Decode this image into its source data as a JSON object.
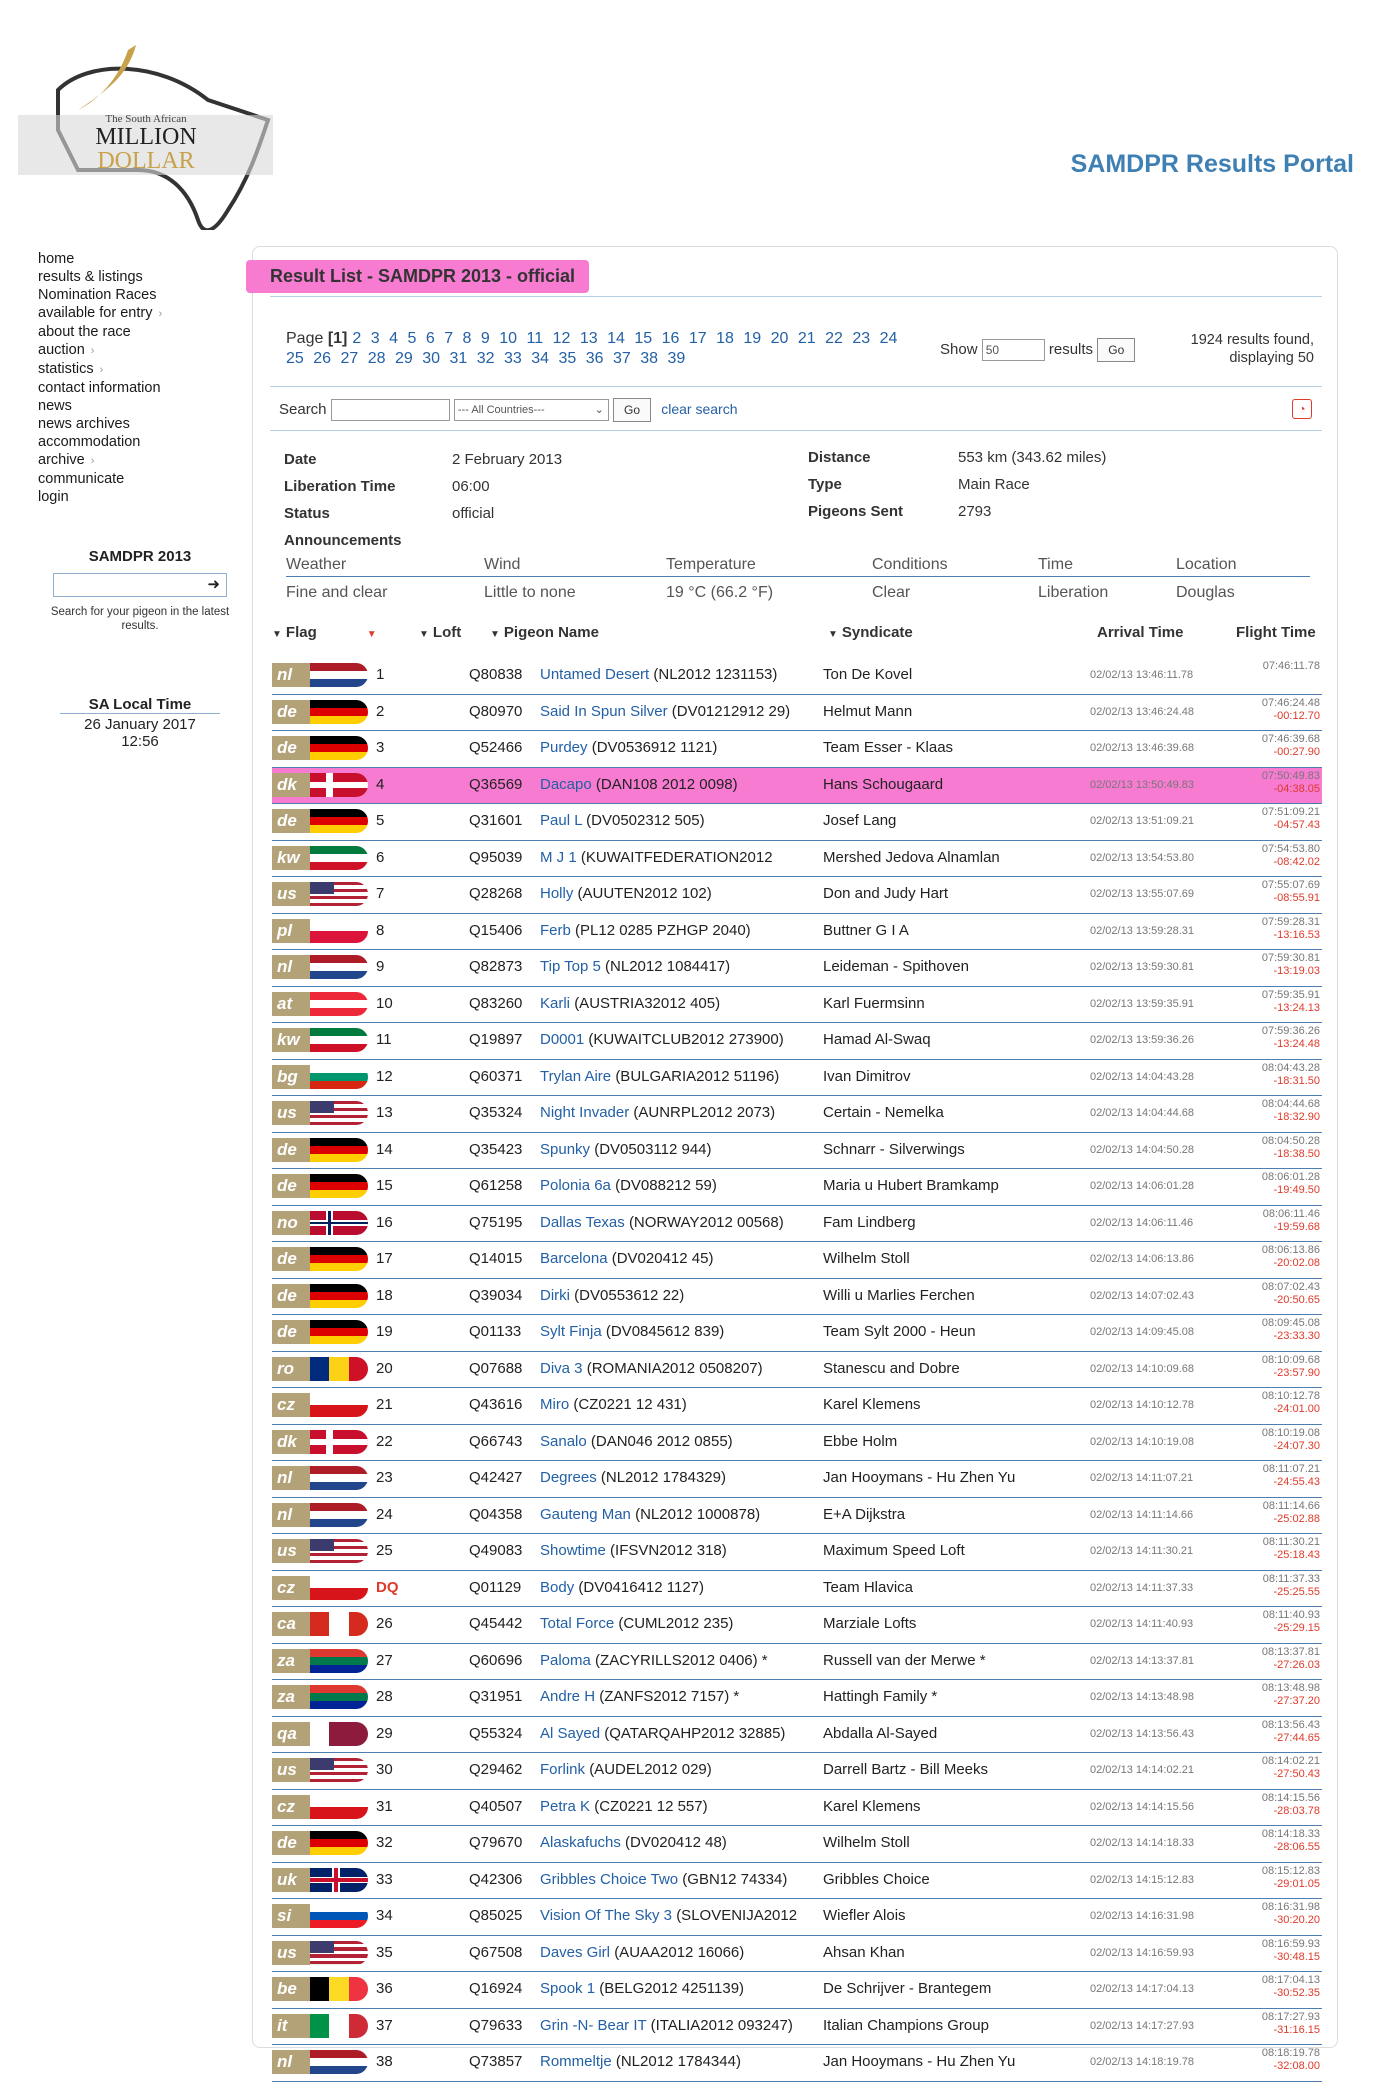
{
  "site": {
    "logo_small": "The South African",
    "logo_line1": "MILLION",
    "logo_line2": "DOLLAR",
    "portal_title": "SAMDPR Results Portal"
  },
  "nav": [
    "home",
    "results & listings",
    "Nomination Races",
    "available for entry",
    "about the race",
    "auction",
    "statistics",
    "contact information",
    "news",
    "news archives",
    "accommodation",
    "archive",
    "communicate",
    "login"
  ],
  "sidebox": {
    "title": "SAMDPR 2013",
    "hint": "Search for your pigeon in the latest results."
  },
  "localtime": {
    "title": "SA Local Time",
    "date": "26 January 2017",
    "time": "12:56"
  },
  "result": {
    "title": "Result List - SAMDPR 2013 - official",
    "page_label": "Page",
    "current_page": "[1]",
    "pages": [
      "2",
      "3",
      "4",
      "5",
      "6",
      "7",
      "8",
      "9",
      "10",
      "11",
      "12",
      "13",
      "14",
      "15",
      "16",
      "17",
      "18",
      "19",
      "20",
      "21",
      "22",
      "23",
      "24",
      "25",
      "26",
      "27",
      "28",
      "29",
      "30",
      "31",
      "32",
      "33",
      "34",
      "35",
      "36",
      "37",
      "38",
      "39"
    ],
    "show_label": "Show",
    "show_value": "50",
    "results_label": "results",
    "go": "Go",
    "found": "1924 results found, displaying 50"
  },
  "search": {
    "label": "Search",
    "country": "--- All Countries---",
    "go": "Go",
    "clear": "clear search"
  },
  "info": {
    "date_l": "Date",
    "date": "2 February 2013",
    "lib_l": "Liberation Time",
    "lib": "06:00",
    "status_l": "Status",
    "status": "official",
    "ann_l": "Announcements",
    "dist_l": "Distance",
    "dist": "553 km (343.62 miles)",
    "type_l": "Type",
    "type": "Main Race",
    "sent_l": "Pigeons Sent",
    "sent": "2793"
  },
  "weather": {
    "h": [
      "Weather",
      "Wind",
      "Temperature",
      "Conditions",
      "Time",
      "Location"
    ],
    "v": [
      "Fine and clear",
      "Little to none",
      "19 °C (66.2 °F)",
      "Clear",
      "Liberation",
      "Douglas"
    ]
  },
  "columns": {
    "flag": "Flag",
    "loft": "Loft",
    "name": "Pigeon Name",
    "synd": "Syndicate",
    "arr": "Arrival Time",
    "flight": "Flight Time"
  },
  "colors": {
    "accent": "#3f80b4",
    "highlight": "#f67bd1",
    "link": "#2360a5",
    "diff": "#e03a2a"
  },
  "rows": [
    {
      "c": "nl",
      "r": "1",
      "l": "Q80838",
      "n": "Untamed Desert",
      "ring": "(NL2012 1231153)",
      "s": "Ton De Kovel",
      "a": "02/02/13 13:46:11.78",
      "f": "07:46:11.78",
      "d": ""
    },
    {
      "c": "de",
      "r": "2",
      "l": "Q80970",
      "n": "Said In Spun Silver",
      "ring": "(DV01212912 29)",
      "s": "Helmut Mann",
      "a": "02/02/13 13:46:24.48",
      "f": "07:46:24.48",
      "d": "-00:12.70"
    },
    {
      "c": "de",
      "r": "3",
      "l": "Q52466",
      "n": "Purdey",
      "ring": "(DV0536912 1121)",
      "s": "Team Esser - Klaas",
      "a": "02/02/13 13:46:39.68",
      "f": "07:46:39.68",
      "d": "-00:27.90"
    },
    {
      "c": "dk",
      "r": "4",
      "l": "Q36569",
      "n": "Dacapo",
      "ring": "(DAN108 2012 0098)",
      "s": "Hans Schougaard",
      "a": "02/02/13 13:50:49.83",
      "f": "07:50:49.83",
      "d": "-04:38.05",
      "hl": true
    },
    {
      "c": "de",
      "r": "5",
      "l": "Q31601",
      "n": "Paul L",
      "ring": "(DV0502312 505)",
      "s": "Josef Lang",
      "a": "02/02/13 13:51:09.21",
      "f": "07:51:09.21",
      "d": "-04:57.43"
    },
    {
      "c": "kw",
      "r": "6",
      "l": "Q95039",
      "n": "M J 1",
      "ring": "(KUWAITFEDERATION2012",
      "s": "Mershed Jedova Alnamlan",
      "a": "02/02/13 13:54:53.80",
      "f": "07:54:53.80",
      "d": "-08:42.02"
    },
    {
      "c": "us",
      "r": "7",
      "l": "Q28268",
      "n": "Holly",
      "ring": "(AUUTEN2012 102)",
      "s": "Don and Judy Hart",
      "a": "02/02/13 13:55:07.69",
      "f": "07:55:07.69",
      "d": "-08:55.91"
    },
    {
      "c": "pl",
      "r": "8",
      "l": "Q15406",
      "n": "Ferb",
      "ring": "(PL12 0285 PZHGP 2040)",
      "s": "Buttner G I A",
      "a": "02/02/13 13:59:28.31",
      "f": "07:59:28.31",
      "d": "-13:16.53"
    },
    {
      "c": "nl",
      "r": "9",
      "l": "Q82873",
      "n": "Tip Top 5",
      "ring": "(NL2012 1084417)",
      "s": "Leideman - Spithoven",
      "a": "02/02/13 13:59:30.81",
      "f": "07:59:30.81",
      "d": "-13:19.03"
    },
    {
      "c": "at",
      "r": "10",
      "l": "Q83260",
      "n": "Karli",
      "ring": "(AUSTRIA32012 405)",
      "s": "Karl Fuermsinn",
      "a": "02/02/13 13:59:35.91",
      "f": "07:59:35.91",
      "d": "-13:24.13"
    },
    {
      "c": "kw",
      "r": "11",
      "l": "Q19897",
      "n": "D0001",
      "ring": "(KUWAITCLUB2012 273900)",
      "s": "Hamad Al-Swaq",
      "a": "02/02/13 13:59:36.26",
      "f": "07:59:36.26",
      "d": "-13:24.48"
    },
    {
      "c": "bg",
      "r": "12",
      "l": "Q60371",
      "n": "Trylan Aire",
      "ring": "(BULGARIA2012 51196)",
      "s": "Ivan Dimitrov",
      "a": "02/02/13 14:04:43.28",
      "f": "08:04:43.28",
      "d": "-18:31.50"
    },
    {
      "c": "us",
      "r": "13",
      "l": "Q35324",
      "n": "Night Invader",
      "ring": "(AUNRPL2012 2073)",
      "s": "Certain - Nemelka",
      "a": "02/02/13 14:04:44.68",
      "f": "08:04:44.68",
      "d": "-18:32.90"
    },
    {
      "c": "de",
      "r": "14",
      "l": "Q35423",
      "n": "Spunky",
      "ring": "(DV0503112 944)",
      "s": "Schnarr - Silverwings",
      "a": "02/02/13 14:04:50.28",
      "f": "08:04:50.28",
      "d": "-18:38.50"
    },
    {
      "c": "de",
      "r": "15",
      "l": "Q61258",
      "n": "Polonia 6a",
      "ring": "(DV088212 59)",
      "s": "Maria u Hubert Bramkamp",
      "a": "02/02/13 14:06:01.28",
      "f": "08:06:01.28",
      "d": "-19:49.50"
    },
    {
      "c": "no",
      "r": "16",
      "l": "Q75195",
      "n": "Dallas Texas",
      "ring": "(NORWAY2012 00568)",
      "s": "Fam Lindberg",
      "a": "02/02/13 14:06:11.46",
      "f": "08:06:11.46",
      "d": "-19:59.68"
    },
    {
      "c": "de",
      "r": "17",
      "l": "Q14015",
      "n": "Barcelona",
      "ring": "(DV020412 45)",
      "s": "Wilhelm Stoll",
      "a": "02/02/13 14:06:13.86",
      "f": "08:06:13.86",
      "d": "-20:02.08"
    },
    {
      "c": "de",
      "r": "18",
      "l": "Q39034",
      "n": "Dirki",
      "ring": "(DV0553612 22)",
      "s": "Willi u Marlies Ferchen",
      "a": "02/02/13 14:07:02.43",
      "f": "08:07:02.43",
      "d": "-20:50.65"
    },
    {
      "c": "de",
      "r": "19",
      "l": "Q01133",
      "n": "Sylt Finja",
      "ring": "(DV0845612 839)",
      "s": "Team Sylt 2000 - Heun",
      "a": "02/02/13 14:09:45.08",
      "f": "08:09:45.08",
      "d": "-23:33.30"
    },
    {
      "c": "ro",
      "r": "20",
      "l": "Q07688",
      "n": "Diva 3",
      "ring": "(ROMANIA2012 0508207)",
      "s": "Stanescu and Dobre",
      "a": "02/02/13 14:10:09.68",
      "f": "08:10:09.68",
      "d": "-23:57.90"
    },
    {
      "c": "cz",
      "r": "21",
      "l": "Q43616",
      "n": "Miro",
      "ring": "(CZ0221 12 431)",
      "s": "Karel Klemens",
      "a": "02/02/13 14:10:12.78",
      "f": "08:10:12.78",
      "d": "-24:01.00"
    },
    {
      "c": "dk",
      "r": "22",
      "l": "Q66743",
      "n": "Sanalo",
      "ring": "(DAN046 2012 0855)",
      "s": "Ebbe Holm",
      "a": "02/02/13 14:10:19.08",
      "f": "08:10:19.08",
      "d": "-24:07.30"
    },
    {
      "c": "nl",
      "r": "23",
      "l": "Q42427",
      "n": "Degrees",
      "ring": "(NL2012 1784329)",
      "s": "Jan Hooymans - Hu Zhen Yu",
      "a": "02/02/13 14:11:07.21",
      "f": "08:11:07.21",
      "d": "-24:55.43"
    },
    {
      "c": "nl",
      "r": "24",
      "l": "Q04358",
      "n": "Gauteng Man",
      "ring": "(NL2012 1000878)",
      "s": "E+A Dijkstra",
      "a": "02/02/13 14:11:14.66",
      "f": "08:11:14.66",
      "d": "-25:02.88"
    },
    {
      "c": "us",
      "r": "25",
      "l": "Q49083",
      "n": "Showtime",
      "ring": "(IFSVN2012 318)",
      "s": "Maximum Speed Loft",
      "a": "02/02/13 14:11:30.21",
      "f": "08:11:30.21",
      "d": "-25:18.43"
    },
    {
      "c": "cz",
      "r": "DQ",
      "l": "Q01129",
      "n": "Body",
      "ring": "(DV0416412 1127)",
      "s": "Team Hlavica",
      "a": "02/02/13 14:11:37.33",
      "f": "08:11:37.33",
      "d": "-25:25.55",
      "dq": true
    },
    {
      "c": "ca",
      "r": "26",
      "l": "Q45442",
      "n": "Total Force",
      "ring": "(CUML2012 235)",
      "s": "Marziale Lofts",
      "a": "02/02/13 14:11:40.93",
      "f": "08:11:40.93",
      "d": "-25:29.15"
    },
    {
      "c": "za",
      "r": "27",
      "l": "Q60696",
      "n": "Paloma",
      "ring": "(ZACYRILLS2012 0406) *",
      "s": "Russell van der Merwe *",
      "a": "02/02/13 14:13:37.81",
      "f": "08:13:37.81",
      "d": "-27:26.03"
    },
    {
      "c": "za",
      "r": "28",
      "l": "Q31951",
      "n": "Andre H",
      "ring": "(ZANFS2012 7157) *",
      "s": "Hattingh Family *",
      "a": "02/02/13 14:13:48.98",
      "f": "08:13:48.98",
      "d": "-27:37.20"
    },
    {
      "c": "qa",
      "r": "29",
      "l": "Q55324",
      "n": "Al Sayed",
      "ring": "(QATARQAHP2012 32885)",
      "s": "Abdalla Al-Sayed",
      "a": "02/02/13 14:13:56.43",
      "f": "08:13:56.43",
      "d": "-27:44.65"
    },
    {
      "c": "us",
      "r": "30",
      "l": "Q29462",
      "n": "Forlink",
      "ring": "(AUDEL2012 029)",
      "s": "Darrell Bartz - Bill Meeks",
      "a": "02/02/13 14:14:02.21",
      "f": "08:14:02.21",
      "d": "-27:50.43"
    },
    {
      "c": "cz",
      "r": "31",
      "l": "Q40507",
      "n": "Petra K",
      "ring": "(CZ0221 12 557)",
      "s": "Karel Klemens",
      "a": "02/02/13 14:14:15.56",
      "f": "08:14:15.56",
      "d": "-28:03.78"
    },
    {
      "c": "de",
      "r": "32",
      "l": "Q79670",
      "n": "Alaskafuchs",
      "ring": "(DV020412 48)",
      "s": "Wilhelm Stoll",
      "a": "02/02/13 14:14:18.33",
      "f": "08:14:18.33",
      "d": "-28:06.55"
    },
    {
      "c": "uk",
      "r": "33",
      "l": "Q42306",
      "n": "Gribbles Choice Two",
      "ring": "(GBN12 74334)",
      "s": "Gribbles Choice",
      "a": "02/02/13 14:15:12.83",
      "f": "08:15:12.83",
      "d": "-29:01.05"
    },
    {
      "c": "si",
      "r": "34",
      "l": "Q85025",
      "n": "Vision Of The Sky 3",
      "ring": "(SLOVENIJA2012",
      "s": "Wiefler Alois",
      "a": "02/02/13 14:16:31.98",
      "f": "08:16:31.98",
      "d": "-30:20.20"
    },
    {
      "c": "us",
      "r": "35",
      "l": "Q67508",
      "n": "Daves Girl",
      "ring": "(AUAA2012 16066)",
      "s": "Ahsan Khan",
      "a": "02/02/13 14:16:59.93",
      "f": "08:16:59.93",
      "d": "-30:48.15"
    },
    {
      "c": "be",
      "r": "36",
      "l": "Q16924",
      "n": "Spook 1",
      "ring": "(BELG2012 4251139)",
      "s": "De Schrijver - Brantegem",
      "a": "02/02/13 14:17:04.13",
      "f": "08:17:04.13",
      "d": "-30:52.35"
    },
    {
      "c": "it",
      "r": "37",
      "l": "Q79633",
      "n": "Grin -N- Bear IT",
      "ring": "(ITALIA2012 093247)",
      "s": "Italian Champions Group",
      "a": "02/02/13 14:17:27.93",
      "f": "08:17:27.93",
      "d": "-31:16.15"
    },
    {
      "c": "nl",
      "r": "38",
      "l": "Q73857",
      "n": "Rommeltje",
      "ring": "(NL2012 1784344)",
      "s": "Jan Hooymans - Hu Zhen Yu",
      "a": "02/02/13 14:18:19.78",
      "f": "08:18:19.78",
      "d": "-32:08.00"
    }
  ]
}
